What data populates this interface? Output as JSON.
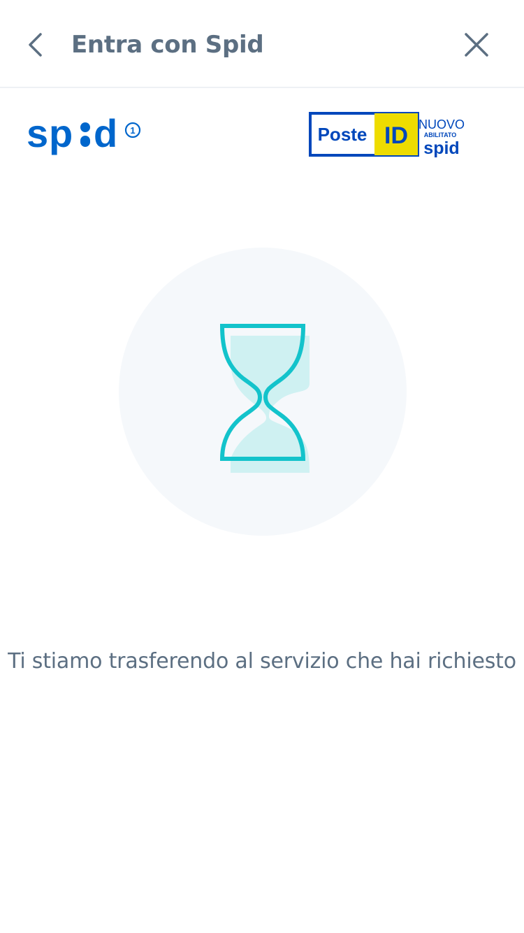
{
  "header": {
    "title": "Entra con Spid",
    "back_icon": "chevron-left-icon",
    "close_icon": "close-icon"
  },
  "logos": {
    "spid": {
      "text": "spid",
      "badge": "1",
      "color": "#0066cc"
    },
    "posteid": {
      "brand": "Poste",
      "id": "ID",
      "tag_new": "NUOVO",
      "tag_enabled": "ABILITATO",
      "tag_spid": "spid",
      "color_blue": "#0047bb",
      "color_yellow": "#eedc00"
    }
  },
  "loader": {
    "icon": "hourglass-icon",
    "color": "#13c3cb",
    "fill": "#cff1f2"
  },
  "status": {
    "message": "Ti stiamo trasferendo al servizio che hai richiesto"
  },
  "colors": {
    "text": "#5c6f82",
    "divider": "#eef1f5",
    "circle": "#f5f8fb"
  }
}
